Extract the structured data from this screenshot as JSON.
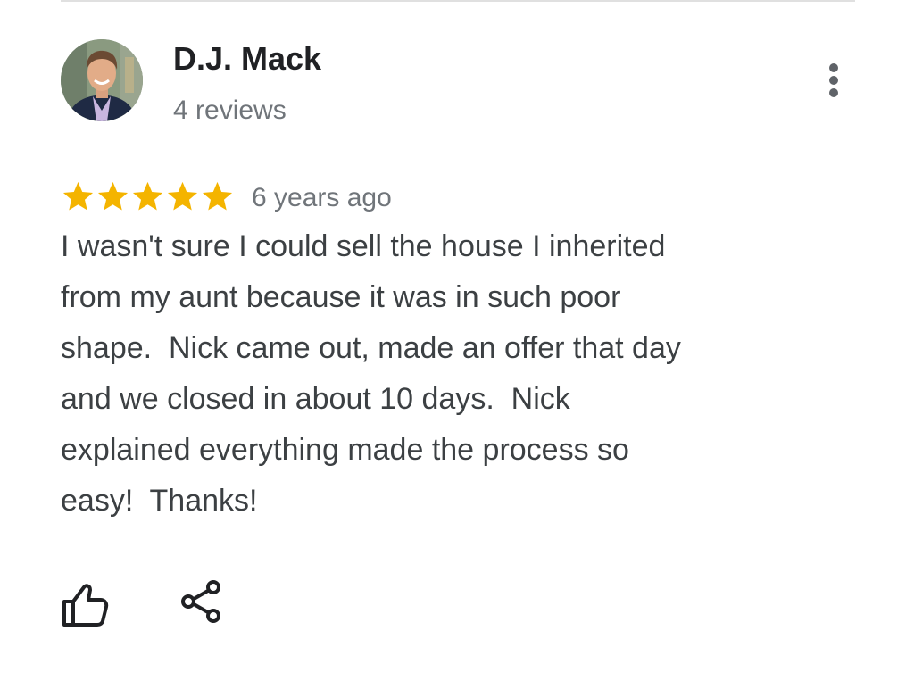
{
  "review": {
    "reviewer_name": "D.J. Mack",
    "review_count": "4 reviews",
    "rating": 5,
    "max_rating": 5,
    "date": "6 years ago",
    "text": "I wasn't sure I could sell the house I inherited\nfrom my aunt because it was in such poor\nshape.  Nick came out, made an offer that day\nand we closed in about 10 days.  Nick\nexplained everything made the process so\neasy!  Thanks!"
  },
  "icons": {
    "avatar": "reviewer-photo",
    "more": "more-vert-icon",
    "star": "star-icon",
    "like": "thumb-up-icon",
    "share": "share-icon"
  },
  "colors": {
    "star": "#F4B400",
    "name": "#202124",
    "secondary_text": "#70757a",
    "body_text": "#3c4043",
    "icon": "#202124"
  }
}
